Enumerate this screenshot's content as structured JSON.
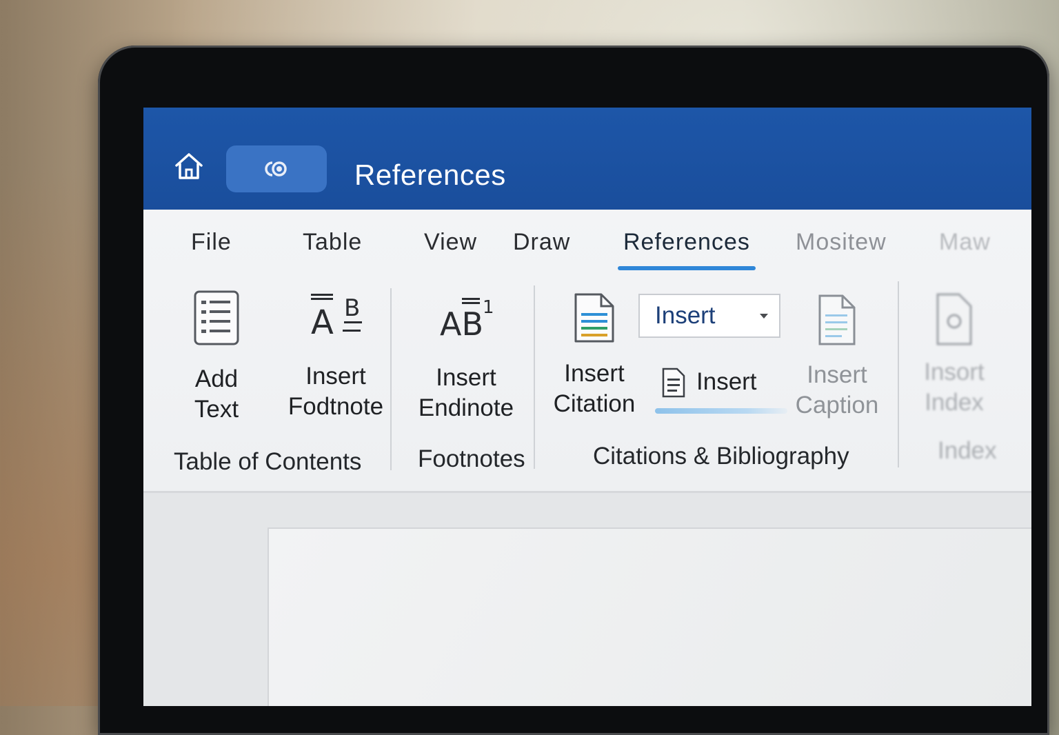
{
  "titlebar": {
    "title": "References"
  },
  "tabs": [
    {
      "label": "File"
    },
    {
      "label": "Table"
    },
    {
      "label": "View"
    },
    {
      "label": "Draw"
    },
    {
      "label": "References",
      "active": true
    },
    {
      "label": "Mositew"
    },
    {
      "label": "Maw"
    }
  ],
  "ribbon": {
    "toc_group": {
      "label": "Table of Contents",
      "add_text": {
        "line1": "Add",
        "line2": "Text"
      },
      "insert_footnote": {
        "line1": "Insert",
        "line2": "Fodtnote"
      }
    },
    "footnotes_group": {
      "label": "Footnotes",
      "insert_endnote": {
        "line1": "Insert",
        "line2": "Endinote"
      }
    },
    "citations_group": {
      "label": "Citations & Bibliography",
      "insert_citation": {
        "line1": "Insert",
        "line2": "Citation"
      },
      "style_dropdown": {
        "value": "Insert"
      },
      "insert_small": {
        "label": "Insert"
      },
      "insert_caption": {
        "line1": "Insert",
        "line2": "Caption"
      }
    },
    "index_group": {
      "label": "Index",
      "insert_index": {
        "line1": "Insort",
        "line2": "Index"
      }
    }
  },
  "colors": {
    "titlebar": "#1a4e9c",
    "accent_underline": "#2f86d8",
    "ribbon_bg": "#f1f2f4"
  },
  "icons": [
    "home-icon",
    "link-icon",
    "add-text-icon",
    "insert-footnote-icon",
    "insert-endnote-icon",
    "insert-citation-icon",
    "dropdown-caret-icon",
    "document-icon",
    "insert-caption-icon",
    "insert-index-icon"
  ]
}
